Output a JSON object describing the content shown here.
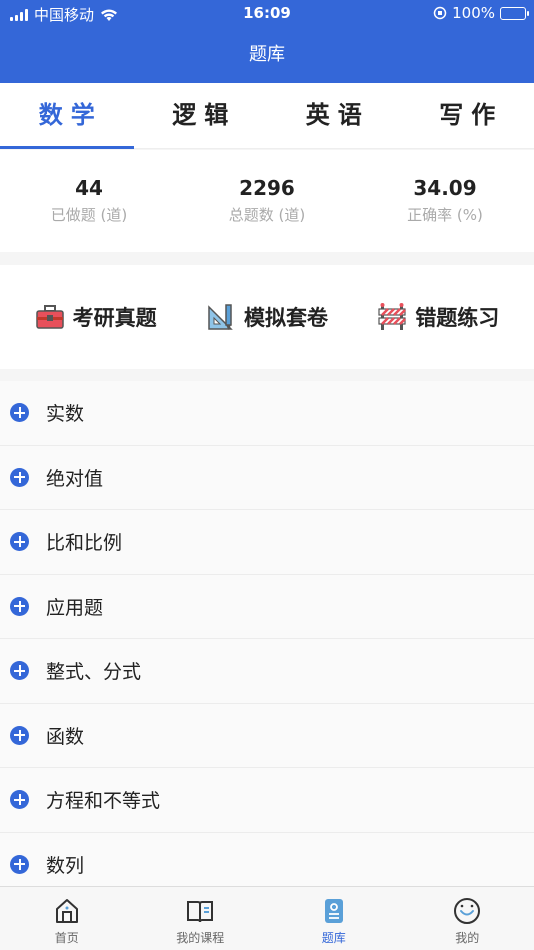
{
  "status": {
    "carrier": "中国移动",
    "time": "16:09",
    "battery": "100%"
  },
  "nav": {
    "title": "题库"
  },
  "tabs": [
    {
      "label": "数学",
      "active": true
    },
    {
      "label": "逻辑",
      "active": false
    },
    {
      "label": "英语",
      "active": false
    },
    {
      "label": "写作",
      "active": false
    }
  ],
  "stats": [
    {
      "value": "44",
      "label": "已做题 (道)"
    },
    {
      "value": "2296",
      "label": "总题数 (道)"
    },
    {
      "value": "34.09",
      "label": "正确率 (%)"
    }
  ],
  "quick": [
    {
      "label": "考研真题",
      "icon": "toolbox-icon"
    },
    {
      "label": "模拟套卷",
      "icon": "ruler-pencil-icon"
    },
    {
      "label": "错题练习",
      "icon": "barrier-icon"
    }
  ],
  "topics": [
    "实数",
    "绝对值",
    "比和比例",
    "应用题",
    "整式、分式",
    "函数",
    "方程和不等式",
    "数列"
  ],
  "tabbar": [
    {
      "label": "首页",
      "icon": "home-icon",
      "active": false
    },
    {
      "label": "我的课程",
      "icon": "book-icon",
      "active": false
    },
    {
      "label": "题库",
      "icon": "question-bank-icon",
      "active": true
    },
    {
      "label": "我的",
      "icon": "smile-face-icon",
      "active": false
    }
  ],
  "colors": {
    "primary": "#3467d8",
    "text": "#222222",
    "muted": "#aaaaaa"
  }
}
